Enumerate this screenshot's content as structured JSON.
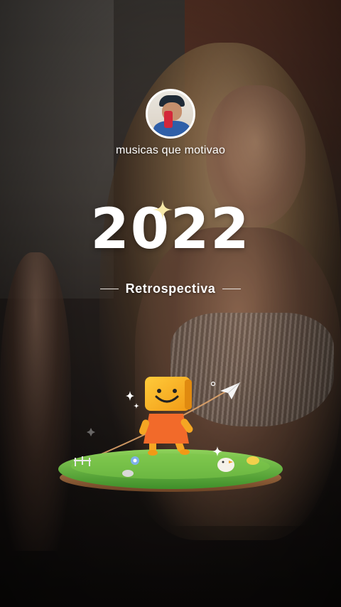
{
  "profile": {
    "name": "musicas que motivao"
  },
  "recap": {
    "year": "2022",
    "subtitle": "Retrospectiva"
  },
  "icons": {
    "year_sparkle": "sparkle-icon",
    "paper_plane": "paper-plane-icon",
    "mascot": "smiley-box-mascot-icon"
  },
  "colors": {
    "text": "#ffffff",
    "mascot": "#f5a623",
    "grass": "#5fb43a"
  }
}
